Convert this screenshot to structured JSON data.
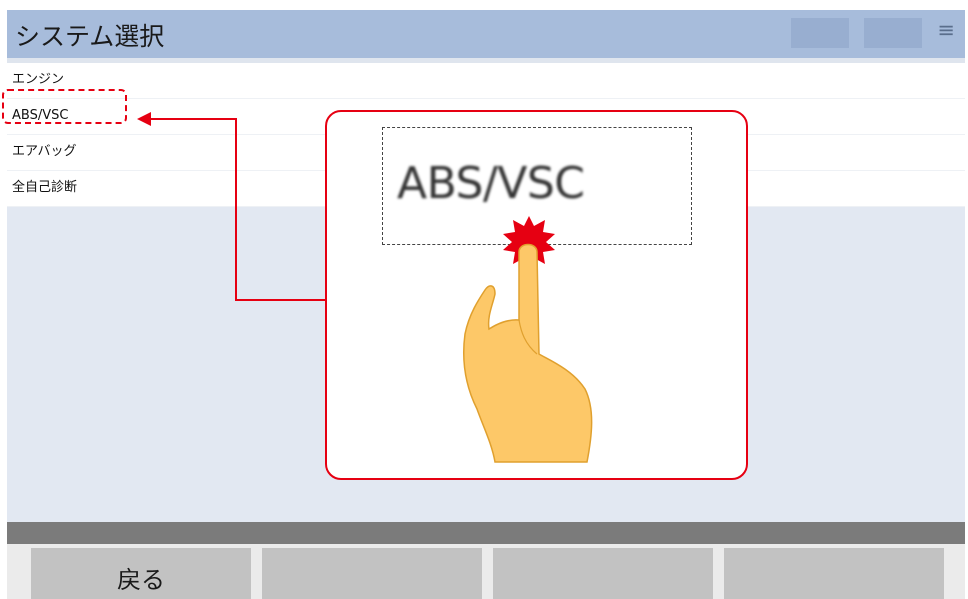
{
  "header": {
    "title": "システム選択",
    "menu_icon": "hamburger-menu-icon"
  },
  "list": {
    "items": [
      {
        "label": "エンジン"
      },
      {
        "label": "ABS/VSC"
      },
      {
        "label": "エアバッグ"
      },
      {
        "label": "全自己診断"
      }
    ]
  },
  "callout": {
    "zoom_text": "ABS/VSC",
    "icons": [
      "tap-burst-icon",
      "pointing-hand-icon"
    ]
  },
  "footer": {
    "back_label": "戻る"
  },
  "colors": {
    "header": "#a7bcdb",
    "background": "#e2e8f2",
    "annotation": "#e60012",
    "hand": "#fdc868",
    "footer_bar": "#7b7b7b",
    "footer_button": "#c2c2c2"
  }
}
